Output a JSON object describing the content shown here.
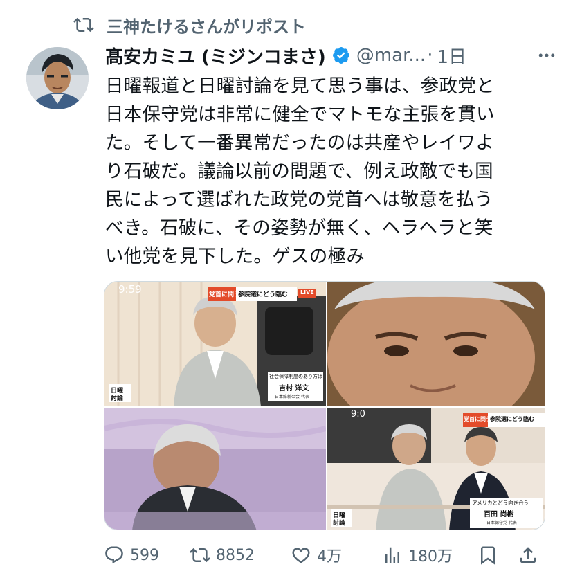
{
  "repost_banner": {
    "text": "三神たけるさんがリポスト"
  },
  "author": {
    "display_name": "髙安カミユ (ミジンコまさ)",
    "handle": "@mar...",
    "separator": "·",
    "time": "1日",
    "verified": true
  },
  "tweet": {
    "lines": [
      "日曜報道と日曜討論を見て思う事は、参政党と",
      "日本保守党は非常に健全でマトモな主張を貫い",
      "た。そして一番異常だったのは共産やレイワよ",
      "り石破だ。議論以前の問題で、例え政敵でも国",
      "民によって選ばれた政党の党首へは敬意を払う",
      "べき。石破に、その姿勢が無く、ヘラヘラと笑",
      "い他党を見下した。ゲスの極み"
    ]
  },
  "media": {
    "tile1": {
      "clock": "9:59",
      "banner_left": "党首に問う",
      "banner_right": "参院選にどう臨む",
      "live": "LIVE",
      "caption_small": "社会保障制度のあり方は",
      "caption_name": "吉村 洋文",
      "caption_party": "日本維新の会 代表",
      "logo_line1": "日曜",
      "logo_line2": "討論"
    },
    "tile4": {
      "clock": "9:0",
      "banner_left": "党首に問う",
      "banner_right": "参院選にどう臨む",
      "caption_small": "アメリカとどう向き合う",
      "caption_name": "百田 尚樹",
      "caption_party": "日本保守党 代表",
      "logo_line1": "日曜",
      "logo_line2": "討論"
    }
  },
  "actions": {
    "replies": "599",
    "reposts": "8852",
    "likes": "4万",
    "views": "180万"
  },
  "colors": {
    "text": "#0f1419",
    "secondary": "#536471",
    "verified": "#1d9bf0"
  }
}
